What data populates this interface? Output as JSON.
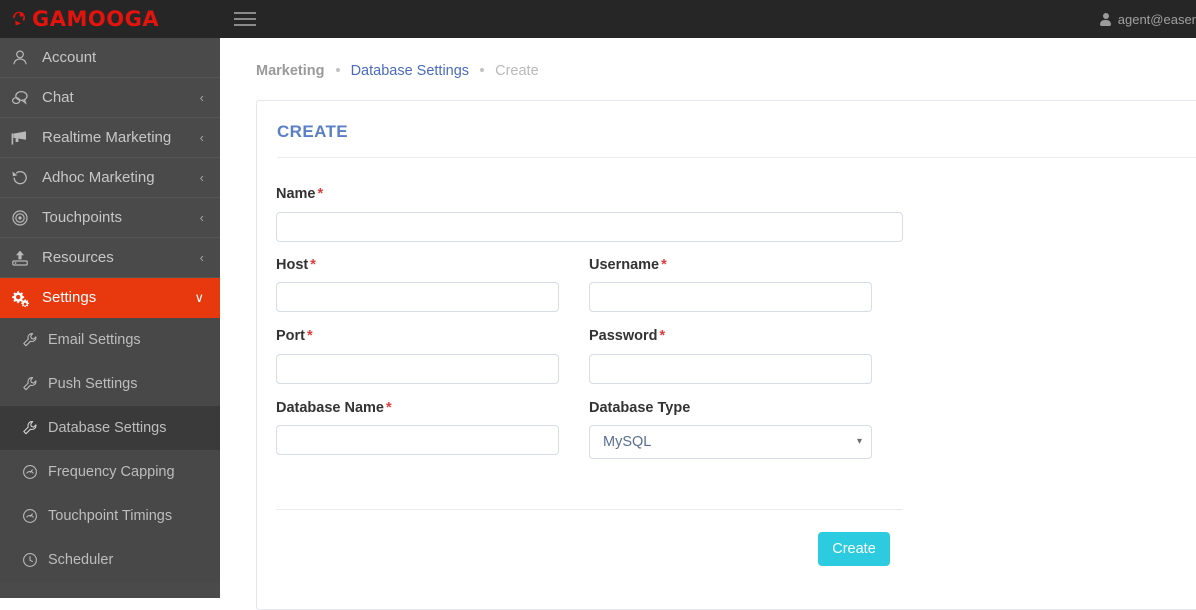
{
  "brand": {
    "logo_text": "GAMOOGA",
    "logo_color": "#e3130e"
  },
  "topbar": {
    "menu_icon": "hamburger-icon",
    "user_icon": "user-icon",
    "user_name": "agent@easer"
  },
  "sidebar": {
    "items": [
      {
        "label": "Account",
        "icon": "user-outline-icon",
        "chevron": "",
        "active": false
      },
      {
        "label": "Chat",
        "icon": "chat-bubbles-icon",
        "chevron": "‹",
        "active": false
      },
      {
        "label": "Realtime Marketing",
        "icon": "megaphone-icon",
        "chevron": "‹",
        "active": false
      },
      {
        "label": "Adhoc Marketing",
        "icon": "history-icon",
        "chevron": "‹",
        "active": false
      },
      {
        "label": "Touchpoints",
        "icon": "target-icon",
        "chevron": "‹",
        "active": false
      },
      {
        "label": "Resources",
        "icon": "upload-icon",
        "chevron": "‹",
        "active": false
      },
      {
        "label": "Settings",
        "icon": "gears-icon",
        "chevron": "∨",
        "active": true
      }
    ],
    "subitems": [
      {
        "label": "Email Settings",
        "icon": "wrench-icon",
        "active": false
      },
      {
        "label": "Push Settings",
        "icon": "wrench-icon",
        "active": false
      },
      {
        "label": "Database Settings",
        "icon": "wrench-icon",
        "active": true
      },
      {
        "label": "Frequency Capping",
        "icon": "gauge-icon",
        "active": false
      },
      {
        "label": "Touchpoint Timings",
        "icon": "gauge-icon",
        "active": false
      },
      {
        "label": "Scheduler",
        "icon": "clock-icon",
        "active": false
      }
    ]
  },
  "breadcrumb": {
    "root": "Marketing",
    "link": "Database Settings",
    "current": "Create"
  },
  "panel": {
    "title": "CREATE",
    "title_color": "#5b7fc7"
  },
  "form": {
    "name": {
      "label": "Name",
      "required": "*",
      "value": "",
      "placeholder": ""
    },
    "host": {
      "label": "Host",
      "required": "*",
      "value": "",
      "placeholder": ""
    },
    "username": {
      "label": "Username",
      "required": "*",
      "value": "",
      "placeholder": ""
    },
    "port": {
      "label": "Port",
      "required": "*",
      "value": "",
      "placeholder": ""
    },
    "password": {
      "label": "Password",
      "required": "*",
      "value": "",
      "placeholder": ""
    },
    "database_name": {
      "label": "Database Name",
      "required": "*",
      "value": "",
      "placeholder": ""
    },
    "database_type": {
      "label": "Database Type",
      "required": "",
      "selected": "MySQL",
      "options": [
        "MySQL"
      ],
      "caret": "▾"
    },
    "submit": {
      "label": "Create",
      "color": "#2ccbe0"
    }
  }
}
